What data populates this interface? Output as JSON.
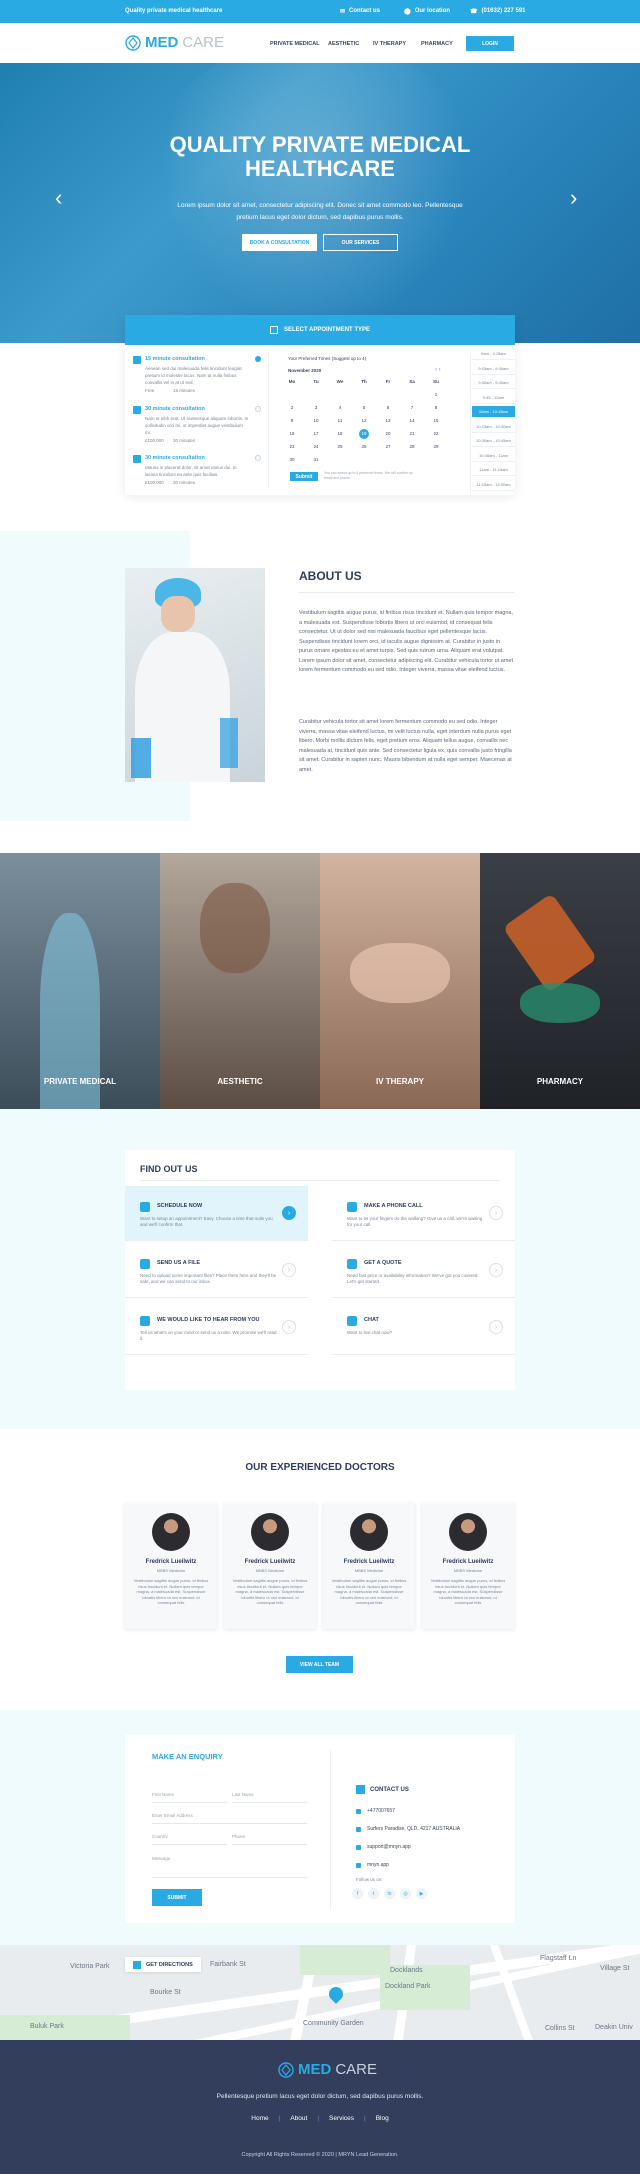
{
  "topbar": {
    "tagline": "Quality private medical healthcare",
    "contact": "Contact us",
    "location": "Our location",
    "phone": "(01632) 227 591"
  },
  "nav": {
    "logo_bold": "MED",
    "logo_light": "CARE",
    "items": [
      "PRIVATE MEDICAL",
      "AESTHETIC",
      "IV THERAPY",
      "PHARMACY"
    ],
    "login": "LOGIN"
  },
  "hero": {
    "title_line1": "QUALITY PRIVATE MEDICAL",
    "title_line2": "HEALTHCARE",
    "subtitle_line1": "Lorem ipsum dolor sit amet, consectetur adipiscing elit. Donec sit amet commodo leo. Pellentesque",
    "subtitle_line2": "pretium lacus eget dolor dictum, sed dapibus purus mollis.",
    "btn_primary": "BOOK A CONSULTATION",
    "btn_secondary": "OUR SERVICES"
  },
  "appointment": {
    "header": "SELECT APPOINTMENT TYPE",
    "types": [
      {
        "title": "15 minute consultation",
        "desc": "Aenean sed dui malesuada felis tincidunt feugiat pretium id molestie lacus. Nam at nulla finibus convallis vel in at ut sed.",
        "price": "Free",
        "time": "15 minutes",
        "selected": true
      },
      {
        "title": "30 minute consultation",
        "desc": "Nam ut nibh erat. Ut scelerisque aliquam lobortis. In sollicitudin orci mi, ut imperdiet augue vestibulum mi.",
        "price": "£100.000",
        "time": "30 minutes",
        "selected": false
      },
      {
        "title": "30 minute consultation",
        "desc": "Mauris in placerat dolor, sit amet varius dui. In lacinia tincidunt eu ante quis facilisis.",
        "price": "£100.000",
        "time": "30 minutes",
        "selected": false
      }
    ],
    "calendar_hint": "Your Preferred Times (Suggest up to 4)",
    "month": "November 2020",
    "weekdays": [
      "Mo",
      "Tu",
      "We",
      "Th",
      "Fr",
      "Sa",
      "Su"
    ],
    "weeks": [
      [
        "",
        "",
        "",
        "",
        "",
        "",
        "1"
      ],
      [
        "2",
        "3",
        "4",
        "5",
        "6",
        "7",
        "8"
      ],
      [
        "9",
        "10",
        "11",
        "12",
        "13",
        "14",
        "15"
      ],
      [
        "16",
        "17",
        "18",
        "19",
        "20",
        "21",
        "22"
      ],
      [
        "23",
        "24",
        "25",
        "26",
        "27",
        "28",
        "29"
      ],
      [
        "30",
        "31",
        "",
        "",
        "",
        "",
        ""
      ]
    ],
    "selected_day": "19",
    "submit": "Submit",
    "note": "You can select up to 4 preferred times. We will confirm by email and phone.",
    "slots": [
      "9am - 9:15am",
      "9:15am - 9:30am",
      "9:30am - 9:45am",
      "9:45 - 10am",
      "10am - 10:15am",
      "10:15am - 10:30am",
      "10:30am - 10:45am",
      "10:45am - 11am",
      "11am - 11:15am",
      "11:15am - 11:30am"
    ],
    "selected_slot": "10am - 10:15am"
  },
  "about": {
    "title": "ABOUT US",
    "para1": "Vestibulum sagittis augue purus, id finibus risus tincidunt et. Nullam quis tempor magna, a malesuada est. Suspendisse lobortis libero ut orci euismod, id consequat felis consectetur. Ut ut dolor sed nisi malesuada faucibus eget pellentesque lacus. Suspendisse tincidunt lorem orci, id iaculis augue dignissim at. Curabitur in justo in purus ornare egestas eu et amet turpis. Sed quis rutrum urna. Aliquam erat volutpat. Lorem ipsum dolor sit amet, consectetur adipiscing elit. Curabitur vehicula tortor ut amet lorem fermentum commodo eu sed odio. Integer viverra, massa vitae eleifend luctus.",
    "para2": "Curabitur vehicula tortor sit amet lorem fermentum commodo eu sed odio. Integer viverra, massa vitae eleifend luctus, mi velit luctus nulla, eget interdum nulla purus eget libero. Morbi mollis dictum felis, eget pretium eros. Aliquam tellus augue, convallis nec malesuada at, tincidunt quis ante. Sed consectetur ligula ex, quis convallis justo fringilla sit amet. Curabitur in sapien nunc. Mauris bibendum at nulla eget semper. Maecenas at amet."
  },
  "services": [
    "PRIVATE MEDICAL",
    "AESTHETIC",
    "IV THERAPY",
    "PHARMACY"
  ],
  "find_us": {
    "title": "FIND OUT US",
    "items": [
      {
        "title": "SCHEDULE NOW",
        "desc": "Want to setup an appointment? Easy. Choose a time that suits you and we'll confirm that."
      },
      {
        "title": "MAKE A PHONE CALL",
        "desc": "Want to let your fingers do the walking? Give us a call, we're waiting for your call."
      },
      {
        "title": "SEND US A FILE",
        "desc": "Need to upload some important files? Place them here and they'll be safe, and we can send to our inbox."
      },
      {
        "title": "GET A QUOTE",
        "desc": "Need fast price or availability information? We've got you covered. Let's get started."
      },
      {
        "title": "WE WOULD LIKE TO HEAR FROM YOU",
        "desc": "Tell us what's on your mind or send us a note. We promise we'll read it."
      },
      {
        "title": "CHAT",
        "desc": "Want to live chat now?"
      }
    ]
  },
  "doctors": {
    "title": "OUR EXPERIENCED DOCTORS",
    "list": [
      {
        "name": "Fredrick Lueilwitz",
        "role": "MBBS Medicine",
        "bio": "Vestibulum sagittis augue purus, id finibus risus tincidunt et. Nullam quis tempor magna, a malesuada est. Suspendisse lobortis libero ut orci euismod, id consequat felis"
      },
      {
        "name": "Fredrick Lueilwitz",
        "role": "MBBS Medicine",
        "bio": "Vestibulum sagittis augue purus, id finibus risus tincidunt et. Nullam quis tempor magna, a malesuada est. Suspendisse lobortis libero ut orci euismod, id consequat felis"
      },
      {
        "name": "Fredrick Lueilwitz",
        "role": "MBBS Medicine",
        "bio": "Vestibulum sagittis augue purus, id finibus risus tincidunt et. Nullam quis tempor magna, a malesuada est. Suspendisse lobortis libero ut orci euismod, id consequat felis"
      },
      {
        "name": "Fredrick Lueilwitz",
        "role": "MBBS Medicine",
        "bio": "Vestibulum sagittis augue purus, id finibus risus tincidunt et. Nullam quis tempor magna, a malesuada est. Suspendisse lobortis libero ut orci euismod, id consequat felis"
      }
    ],
    "view_all": "VIEW ALL TEAM"
  },
  "enquiry": {
    "title": "MAKE AN ENQUIRY",
    "first_name": "First Name",
    "last_name": "Last Name",
    "email": "Enter Email Address",
    "country": "Country",
    "phone": "Phone",
    "message": "Message",
    "submit": "SUBMIT",
    "contact_title": "CONTACT US",
    "contact_phone": "+477007657",
    "contact_address": "Surfers Paradise, QLD, 4217 AUSTRALIA",
    "contact_email": "support@mnyn.app",
    "contact_web": "mnyn.app",
    "follow": "Follow us on:"
  },
  "map": {
    "label": "GET DIRECTIONS",
    "streets": [
      "Victoria Park",
      "Fairbank St",
      "Bourke St",
      "Buluk Park",
      "Dockland Park",
      "Docklands",
      "Collins St",
      "Deakin Univ",
      "Community Garden",
      "Village St",
      "Flagstaff Ln"
    ]
  },
  "footer": {
    "logo_bold": "MED",
    "logo_light": "CARE",
    "tagline": "Pellentesque pretium lacus eget dolor dictum, sed dapibus purus mollis.",
    "links": [
      "Home",
      "About",
      "Services",
      "Blog"
    ],
    "copyright": "Copyright All Rights Reserved © 2020 | MRYN Lead Generation."
  },
  "colors": {
    "accent": "#2aaae2",
    "navy": "#333d5c",
    "light_bg": "#f0fbfe"
  }
}
